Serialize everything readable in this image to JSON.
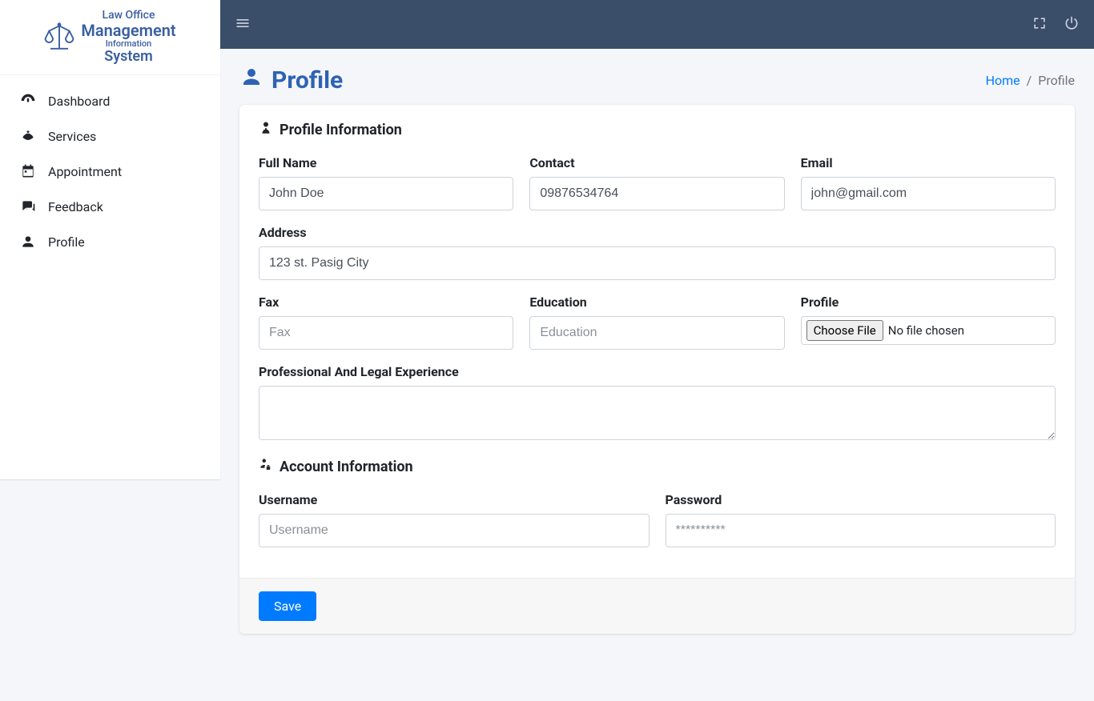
{
  "brand": {
    "line1": "Law Office",
    "line2": "Management",
    "line3": "Information",
    "line4": "System"
  },
  "sidebar": {
    "items": [
      {
        "label": "Dashboard"
      },
      {
        "label": "Services"
      },
      {
        "label": "Appointment"
      },
      {
        "label": "Feedback"
      },
      {
        "label": "Profile"
      }
    ]
  },
  "header": {
    "title": "Profile",
    "breadcrumb_home": "Home",
    "breadcrumb_current": "Profile"
  },
  "sections": {
    "profile_info": "Profile Information",
    "account_info": "Account Information"
  },
  "form": {
    "full_name": {
      "label": "Full Name",
      "value": "John Doe"
    },
    "contact": {
      "label": "Contact",
      "value": "09876534764"
    },
    "email": {
      "label": "Email",
      "value": "john@gmail.com"
    },
    "address": {
      "label": "Address",
      "value": "123 st. Pasig City"
    },
    "fax": {
      "label": "Fax",
      "placeholder": "Fax",
      "value": ""
    },
    "education": {
      "label": "Education",
      "placeholder": "Education",
      "value": ""
    },
    "profile": {
      "label": "Profile",
      "button": "Choose File",
      "no_file": "No file chosen"
    },
    "experience": {
      "label": "Professional And Legal Experience",
      "value": ""
    },
    "username": {
      "label": "Username",
      "placeholder": "Username",
      "value": ""
    },
    "password": {
      "label": "Password",
      "placeholder": "**********",
      "value": ""
    }
  },
  "buttons": {
    "save": "Save"
  }
}
